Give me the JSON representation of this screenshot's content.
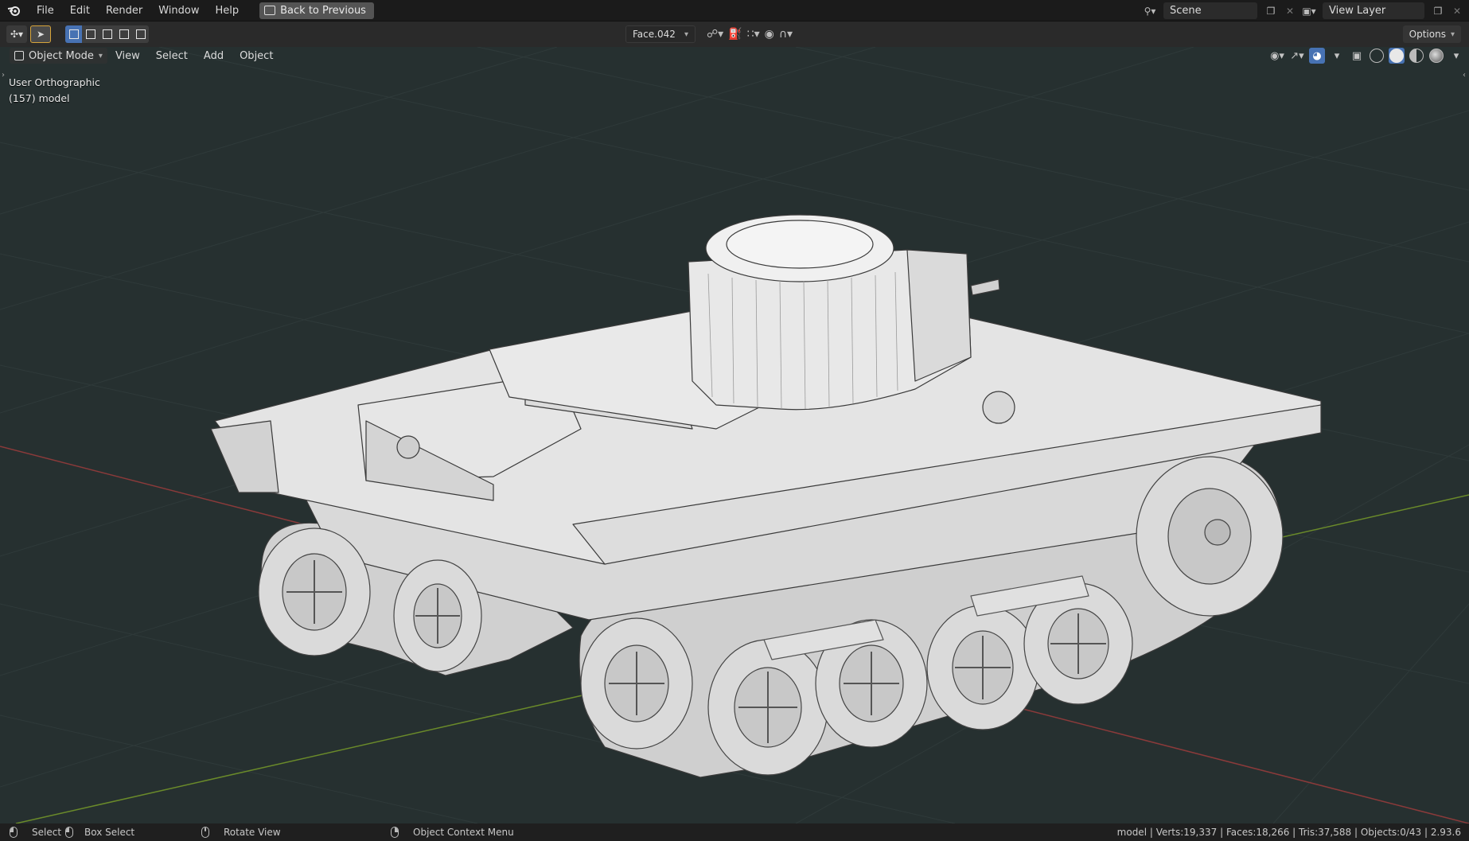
{
  "topbar": {
    "menus": [
      "File",
      "Edit",
      "Render",
      "Window",
      "Help"
    ],
    "back_button": "Back to Previous",
    "scene": "Scene",
    "view_layer": "View Layer"
  },
  "toolheader": {
    "orientation": "Face.042",
    "options": "Options"
  },
  "viewport": {
    "mode": "Object Mode",
    "menus": [
      "View",
      "Select",
      "Add",
      "Object"
    ],
    "view_name": "User Orthographic",
    "object_info": "(157) model",
    "background": "#263030"
  },
  "statusbar": {
    "select": "Select",
    "box_select": "Box Select",
    "rotate_view": "Rotate View",
    "context_menu": "Object Context Menu",
    "stats": "model | Verts:19,337 | Faces:18,266 | Tris:37,588 | Objects:0/43 | 2.93.6"
  },
  "colors": {
    "accent_blue": "#4772b3",
    "x_axis": "#8a3a3a",
    "y_axis": "#6a8a2a"
  }
}
